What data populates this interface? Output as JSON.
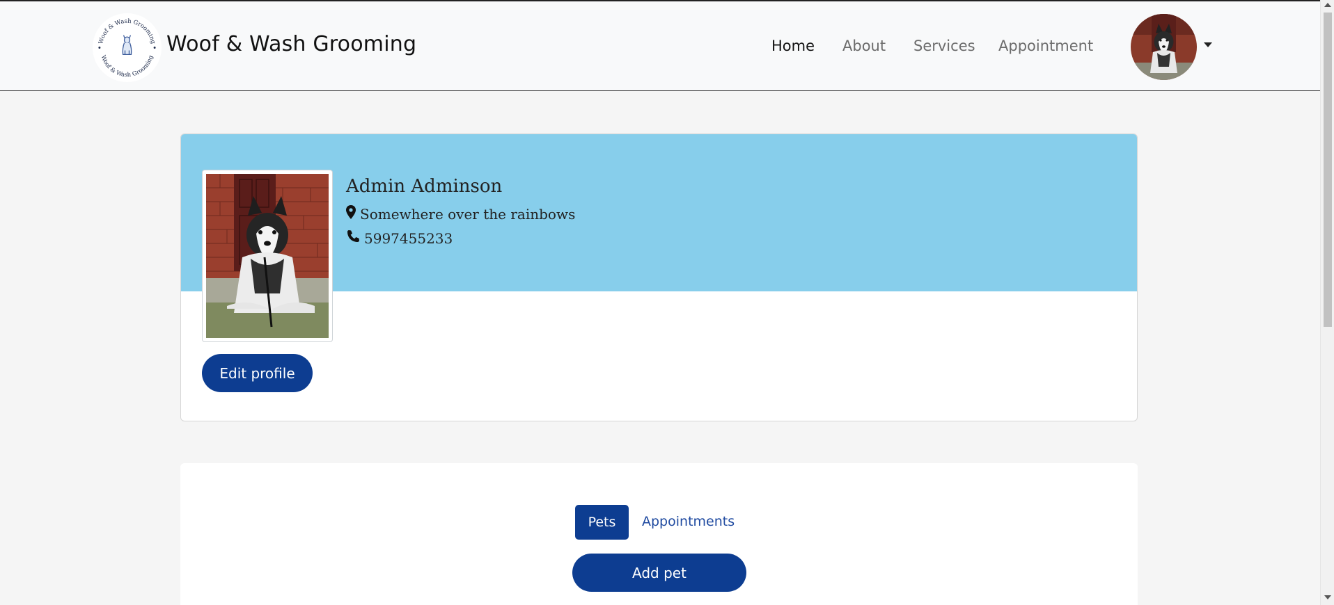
{
  "brand": {
    "name": "Woof & Wash Grooming",
    "logo_ring_text": "Woof & Wash Grooming"
  },
  "nav": {
    "items": [
      {
        "label": "Home",
        "active": true
      },
      {
        "label": "About",
        "active": false
      },
      {
        "label": "Services",
        "active": false
      },
      {
        "label": "Appointment",
        "active": false
      }
    ]
  },
  "profile": {
    "name": "Admin Adminson",
    "location": "Somewhere over the rainbows",
    "phone": "5997455233",
    "edit_label": "Edit profile"
  },
  "tabs": {
    "items": [
      {
        "label": "Pets",
        "active": true
      },
      {
        "label": "Appointments",
        "active": false
      }
    ],
    "add_pet_label": "Add pet"
  },
  "colors": {
    "primary": "#0d3d91",
    "banner": "#87ceeb",
    "page_bg": "#f5f5f5",
    "navbar_bg": "#f8f9fa"
  },
  "icons": [
    "map-marker-icon",
    "phone-icon",
    "chevron-down-icon"
  ]
}
